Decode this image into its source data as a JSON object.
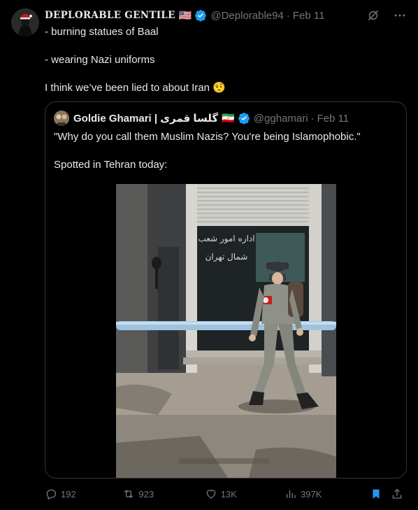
{
  "author": {
    "display_name": "DEPLORABLE GENTILE",
    "flag": "🇺🇸",
    "handle": "@Deplorable94",
    "time": "Feb 11"
  },
  "tweet": {
    "lines": [
      "- burning statues of Baal",
      "- wearing Nazi uniforms",
      "I think we’ve been lied to about Iran 🤨"
    ]
  },
  "quoted": {
    "display_name": "Goldie Ghamari | گلسا قمری",
    "flag": "🇮🇷",
    "handle": "@gghamari",
    "time": "Feb 11",
    "lines": [
      "\"Why do you call them Muslim Nazis? You're being Islamophobic.\"",
      "Spotted in Tehran today:"
    ],
    "media": {
      "sign_text_1": "اداره امور شعب",
      "sign_text_2": "شمال تهران"
    }
  },
  "actions": {
    "replies": "192",
    "reposts": "923",
    "likes": "13K",
    "views": "397K"
  },
  "colors": {
    "background": "#000000",
    "text": "#e7e9ea",
    "muted": "#71767b",
    "accent": "#1d9bf0",
    "border": "#2f3336"
  }
}
